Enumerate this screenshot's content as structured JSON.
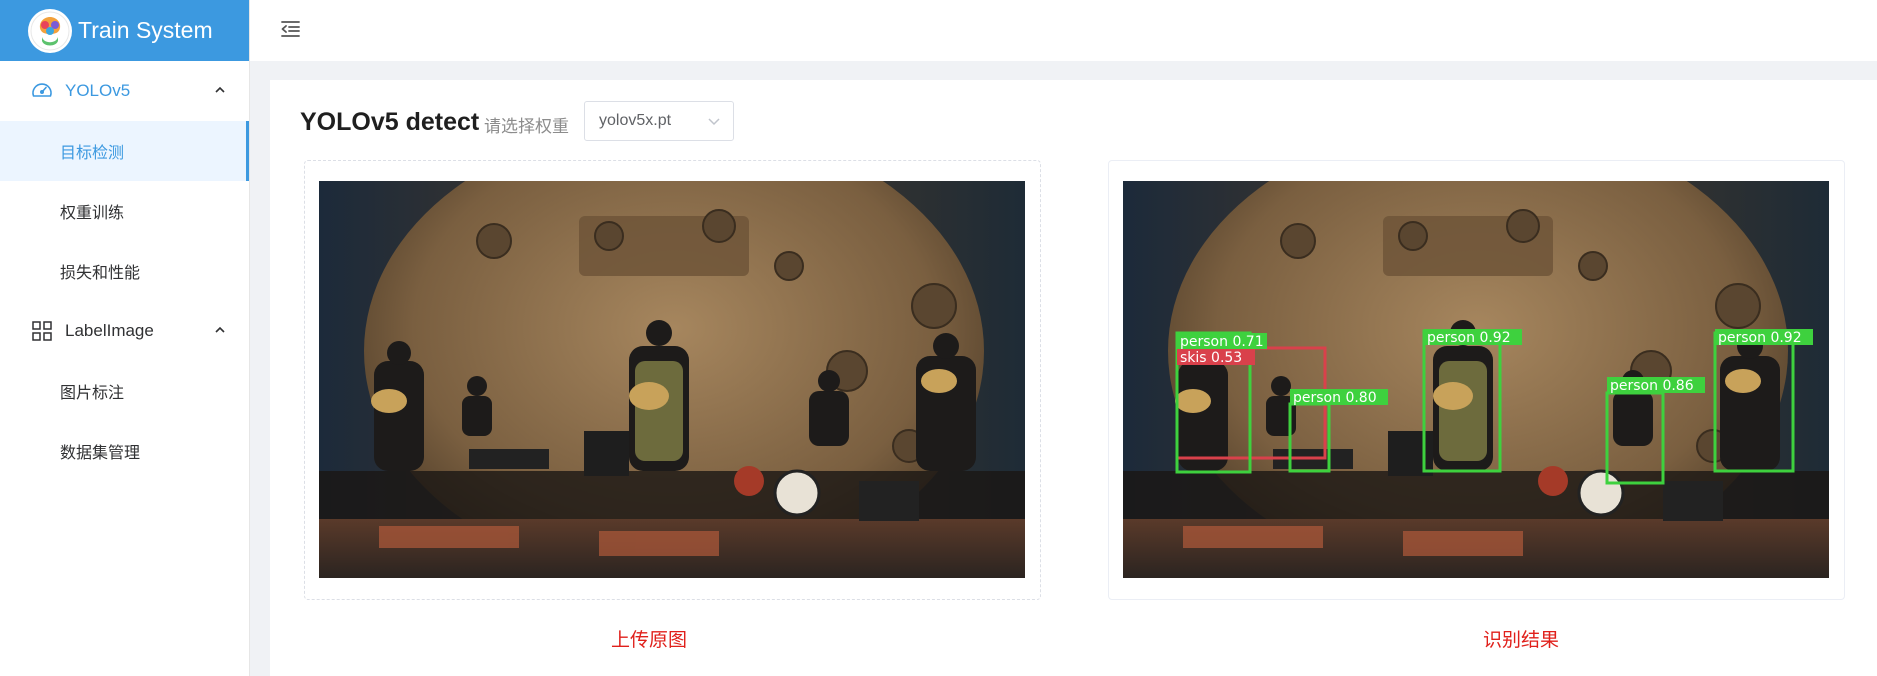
{
  "app": {
    "title": "Train System"
  },
  "sidebar": {
    "groups": [
      {
        "label": "YOLOv5",
        "icon": "dashboard-icon",
        "items": [
          {
            "label": "目标检测"
          },
          {
            "label": "权重训练"
          },
          {
            "label": "损失和性能"
          }
        ]
      },
      {
        "label": "LabelImage",
        "icon": "grid-icon",
        "items": [
          {
            "label": "图片标注"
          },
          {
            "label": "数据集管理"
          }
        ]
      }
    ]
  },
  "main": {
    "title": "YOLOv5 detect",
    "weight_label": "请选择权重",
    "weight_value": "yolov5x.pt",
    "original_caption": "上传原图",
    "result_caption": "识别结果"
  },
  "detections": [
    {
      "label": "person 0.71"
    },
    {
      "label": "skis 0.53"
    },
    {
      "label": "person 0.80"
    },
    {
      "label": "person 0.92"
    },
    {
      "label": "person 0.86"
    },
    {
      "label": "person 0.92"
    }
  ],
  "colors": {
    "accent": "#3c99e0",
    "caption": "#e0201b",
    "box_person": "#3ed13e",
    "box_skis": "#d9414b"
  }
}
